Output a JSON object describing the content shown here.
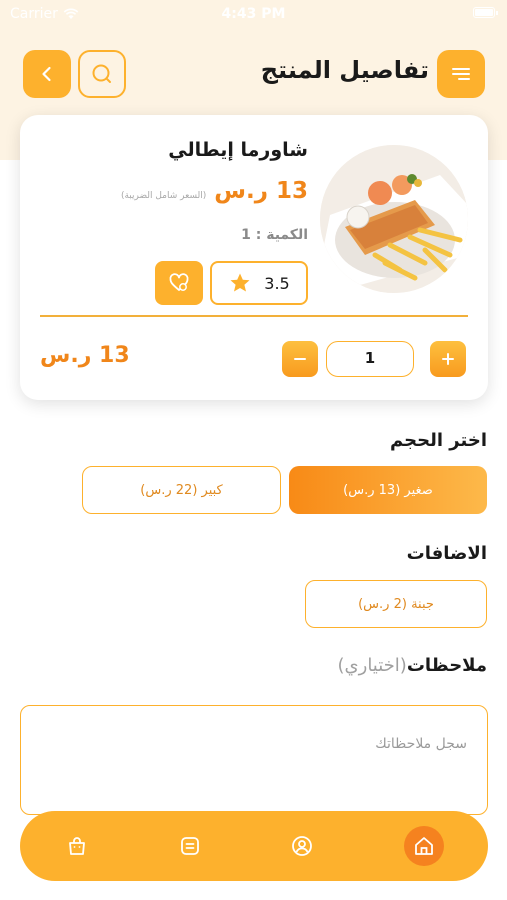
{
  "status_bar": {
    "carrier": "Carrier",
    "time": "4:43 PM"
  },
  "header": {
    "title": "تفاصيل المنتج"
  },
  "product": {
    "name": "شاورما إيطالي",
    "price": "13 ر.س",
    "price_note": "(السعر شامل الضريبة)",
    "quantity_label": "الكمية : 1",
    "rating": "3.5",
    "quantity_value": "1",
    "total": "13 ر.س"
  },
  "size": {
    "title": "اختر الحجم",
    "options": [
      {
        "label": "صغير (13 ر.س)",
        "selected": true
      },
      {
        "label": "كبير (22 ر.س)",
        "selected": false
      }
    ]
  },
  "additions": {
    "title": "الاضافات",
    "options": [
      {
        "label": "جبنة (2 ر.س)"
      }
    ]
  },
  "notes": {
    "title": "ملاحظات",
    "optional": "(اختياري)",
    "placeholder": "سجل ملاحظاتك"
  },
  "nav": [
    "bag-icon",
    "list-icon",
    "user-icon",
    "home-icon"
  ],
  "colors": {
    "accent": "#fdb12d",
    "accent_dark": "#f0861a",
    "background_top": "#fdf3e3"
  }
}
